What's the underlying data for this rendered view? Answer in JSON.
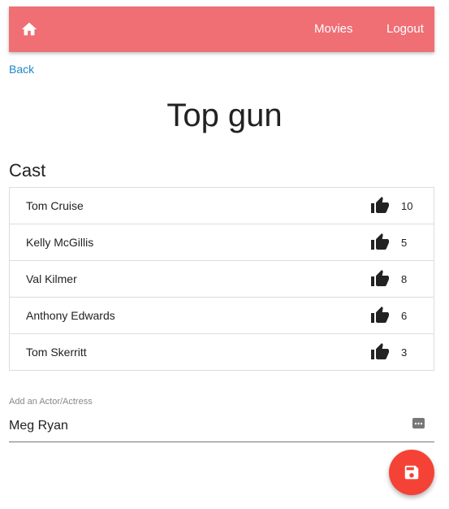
{
  "nav": {
    "home_icon": "home-icon",
    "links": [
      "Movies",
      "Logout"
    ],
    "background_color": "#ef6f75"
  },
  "back_label": "Back",
  "movie": {
    "title": "Top gun"
  },
  "cast": {
    "heading": "Cast",
    "members": [
      {
        "name": "Tom Cruise",
        "likes": "10"
      },
      {
        "name": "Kelly McGillis",
        "likes": "5"
      },
      {
        "name": "Val Kilmer",
        "likes": "8"
      },
      {
        "name": "Anthony Edwards",
        "likes": "6"
      },
      {
        "name": "Tom Skerritt",
        "likes": "3"
      }
    ]
  },
  "add_actor": {
    "label": "Add an Actor/Actress",
    "value": "Meg Ryan",
    "icon": "ellipsis-icon"
  },
  "save_fab": {
    "icon": "floppy-disk-icon",
    "color": "#f44336"
  },
  "colors": {
    "link": "#1e88c8"
  }
}
